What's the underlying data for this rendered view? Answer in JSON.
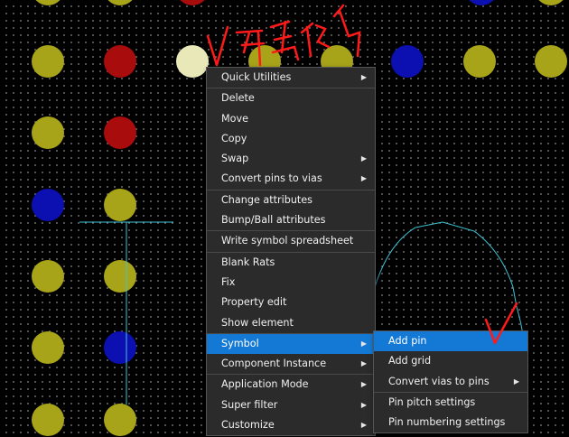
{
  "colors": {
    "pad_yellow": "#a8a41a",
    "pad_red": "#a80c0c",
    "pad_blue": "#0c10b0",
    "pad_selected": "#e8e8b8",
    "trace_cyan": "#3fc3d6",
    "annotation_red": "#ff1a1a",
    "menu_bg": "#2b2b2b",
    "menu_highlight": "#1479d4"
  },
  "context_menu": {
    "items": [
      {
        "label": "Quick Utilities",
        "submenu": true
      },
      {
        "label": "Delete",
        "submenu": false
      },
      {
        "label": "Move",
        "submenu": false
      },
      {
        "label": "Copy",
        "submenu": false
      },
      {
        "label": "Swap",
        "submenu": true
      },
      {
        "label": "Convert pins to vias",
        "submenu": true
      },
      {
        "label": "Change attributes",
        "submenu": false
      },
      {
        "label": "Bump/Ball attributes",
        "submenu": false
      },
      {
        "label": "Write symbol spreadsheet",
        "submenu": false
      },
      {
        "label": "Blank Rats",
        "submenu": false
      },
      {
        "label": "Fix",
        "submenu": false
      },
      {
        "label": "Property edit",
        "submenu": false
      },
      {
        "label": "Show element",
        "submenu": false
      },
      {
        "label": "Symbol",
        "submenu": true
      },
      {
        "label": "Component Instance",
        "submenu": true
      },
      {
        "label": "Application Mode",
        "submenu": true
      },
      {
        "label": "Super filter",
        "submenu": true
      },
      {
        "label": "Customize",
        "submenu": true
      }
    ]
  },
  "symbol_submenu": {
    "items": [
      {
        "label": "Add pin",
        "submenu": false
      },
      {
        "label": "Add grid",
        "submenu": false
      },
      {
        "label": "Convert vias to pins",
        "submenu": true
      },
      {
        "label": "Pin pitch settings",
        "submenu": false
      },
      {
        "label": "Pin numbering settings",
        "submenu": false
      }
    ]
  }
}
